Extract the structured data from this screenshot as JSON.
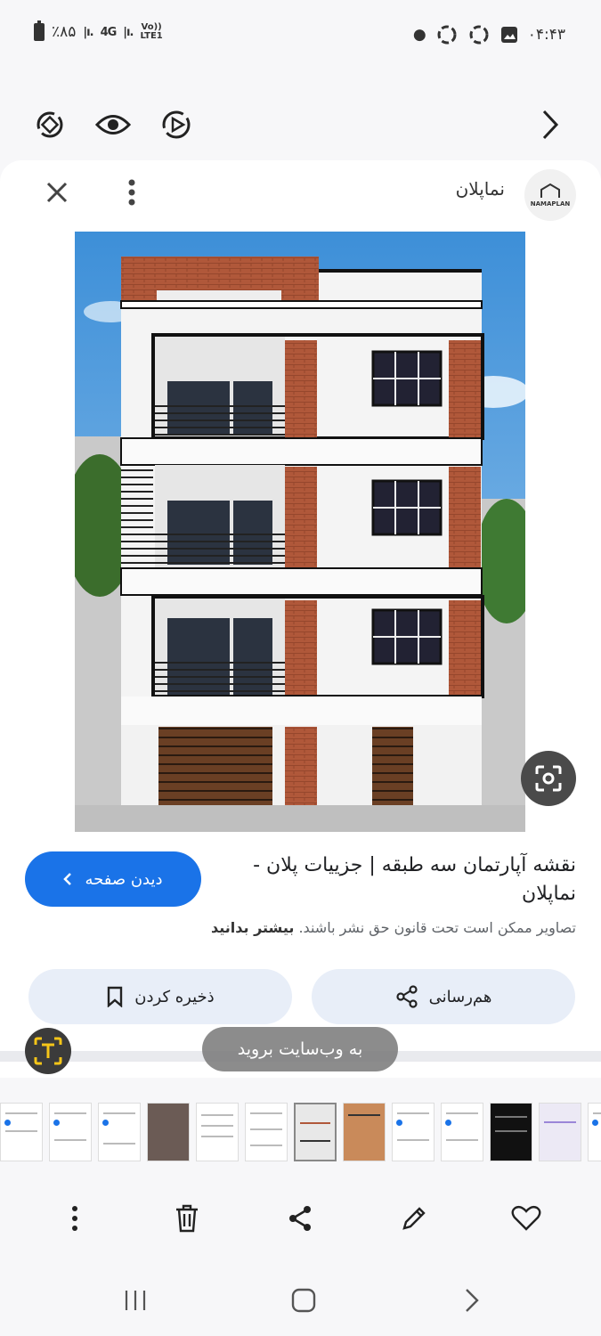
{
  "status_bar": {
    "battery": "٪۸۵",
    "network_1": "4G",
    "network_2_top": "Vo))",
    "network_2_bottom": "LTE1",
    "time": "۰۴:۴۳"
  },
  "card": {
    "site_name": "نماپلان",
    "logo_text": "NAMAPLAN",
    "result_title": "نقشه آپارتمان سه طبقه | جزییات پلان - نماپلان",
    "visit_button": "دیدن صفحه",
    "copyright_text": "تصاویر ممکن است تحت قانون حق نشر باشند.",
    "copyright_link": "بیشتر بدانید",
    "share_label": "هم‌رسانی",
    "save_label": "ذخیره کردن"
  },
  "toast": {
    "text": "به وب‌سایت بروید"
  },
  "colors": {
    "accent": "#1a73e8",
    "pill": "#e8eef8",
    "brick": "#b0583a",
    "sky": "#4a9fe0"
  },
  "icons": {
    "rotate": "rotate-icon",
    "eye": "eye-icon",
    "motion": "motion-photo-icon",
    "next": "chevron-right-icon",
    "close": "close-icon",
    "more": "more-vertical-icon",
    "lens": "lens-search-icon",
    "share": "share-icon",
    "bookmark": "bookmark-icon",
    "delete": "trash-icon",
    "edit": "pencil-icon",
    "favorite": "heart-icon"
  }
}
